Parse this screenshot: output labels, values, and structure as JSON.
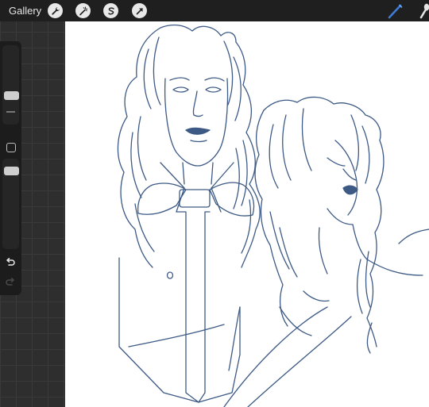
{
  "header": {
    "gallery_label": "Gallery"
  },
  "toolbar": {
    "left_icons": [
      "wrench-icon",
      "magic-wand-icon",
      "selection-icon",
      "transform-arrow-icon"
    ],
    "right_icons": [
      "brush-icon",
      "smudge-icon"
    ],
    "active_brush_color": "#3d7bd6"
  },
  "sidebar": {
    "brush_size_slider": "brush-size-slider",
    "opacity_slider": "opacity-slider",
    "modify_button": "square-icon",
    "undo": "undo-icon",
    "redo": "redo-icon"
  },
  "canvas": {
    "line_color": "#3d5a85",
    "background": "#ffffff"
  }
}
